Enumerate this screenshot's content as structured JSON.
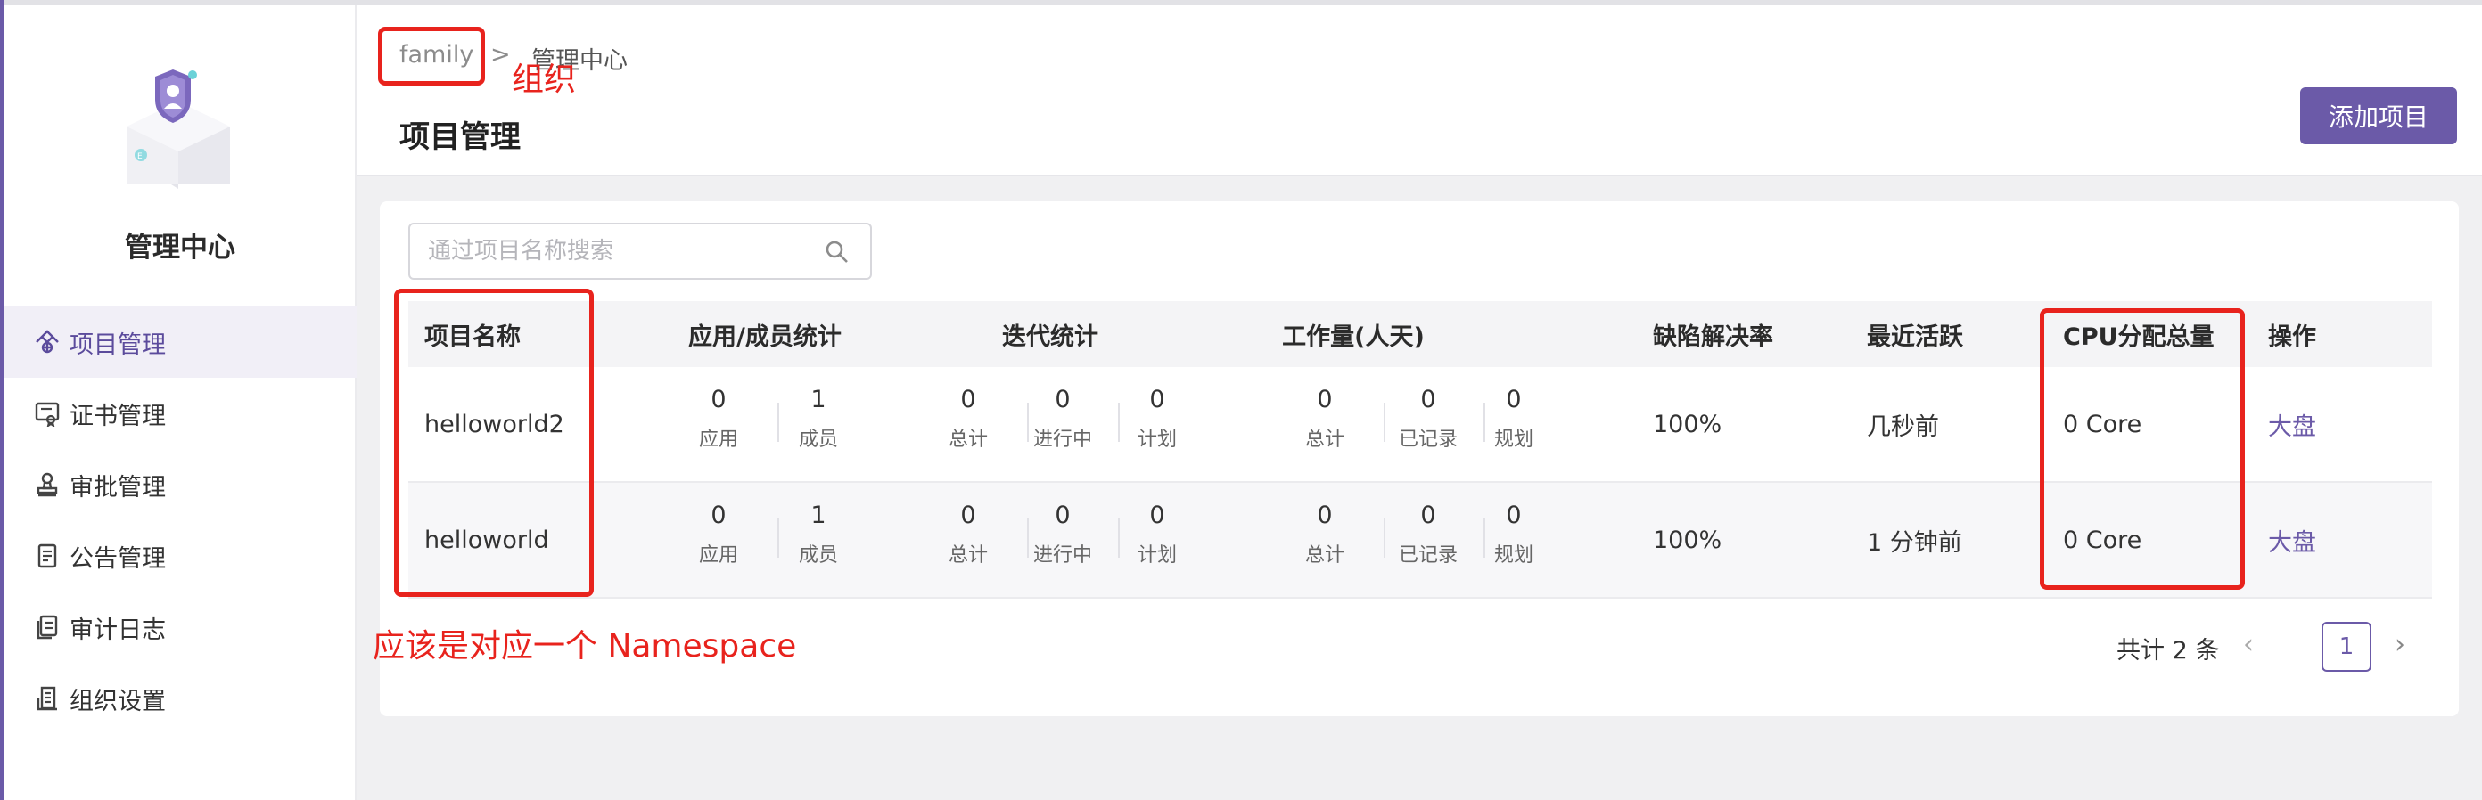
{
  "sidebar": {
    "org_title": "管理中心",
    "items": [
      {
        "label": "项目管理",
        "icon": "project-icon",
        "active": true
      },
      {
        "label": "证书管理",
        "icon": "certificate-icon",
        "active": false
      },
      {
        "label": "审批管理",
        "icon": "approval-stamp-icon",
        "active": false
      },
      {
        "label": "公告管理",
        "icon": "announcement-icon",
        "active": false
      },
      {
        "label": "审计日志",
        "icon": "audit-log-icon",
        "active": false
      },
      {
        "label": "组织设置",
        "icon": "organization-settings-icon",
        "active": false
      }
    ]
  },
  "header": {
    "breadcrumb_org": "family",
    "breadcrumb_sep": ">",
    "breadcrumb_current": "管理中心",
    "page_title": "项目管理",
    "add_button": "添加项目"
  },
  "search": {
    "placeholder": "通过项目名称搜索",
    "value": ""
  },
  "table": {
    "columns": [
      "项目名称",
      "应用/成员统计",
      "迭代统计",
      "工作量(人天)",
      "缺陷解决率",
      "最近活跃",
      "CPU分配总量",
      "操作"
    ],
    "rows": [
      {
        "name": "helloworld2",
        "apps": "0",
        "apps_label": "应用",
        "members": "1",
        "members_label": "成员",
        "iter_total": "0",
        "iter_total_label": "总计",
        "iter_running": "0",
        "iter_running_label": "进行中",
        "iter_plan": "0",
        "iter_plan_label": "计划",
        "work_total": "0",
        "work_total_label": "总计",
        "work_recorded": "0",
        "work_recorded_label": "已记录",
        "work_plan": "0",
        "work_plan_label": "规划",
        "defect_rate": "100%",
        "last_active": "几秒前",
        "cpu": "0 Core",
        "action": "大盘"
      },
      {
        "name": "helloworld",
        "apps": "0",
        "apps_label": "应用",
        "members": "1",
        "members_label": "成员",
        "iter_total": "0",
        "iter_total_label": "总计",
        "iter_running": "0",
        "iter_running_label": "进行中",
        "iter_plan": "0",
        "iter_plan_label": "计划",
        "work_total": "0",
        "work_total_label": "总计",
        "work_recorded": "0",
        "work_recorded_label": "已记录",
        "work_plan": "0",
        "work_plan_label": "规划",
        "defect_rate": "100%",
        "last_active": "1 分钟前",
        "cpu": "0 Core",
        "action": "大盘"
      }
    ]
  },
  "pagination": {
    "total": "共计 2 条",
    "prev": "‹",
    "current": "1",
    "next": "›"
  },
  "annotations": {
    "org_note": "组织",
    "namespace_note": "应该是对应一个 Namespace"
  },
  "colors": {
    "accent": "#6b5aa8",
    "annotation": "#e8231d"
  }
}
